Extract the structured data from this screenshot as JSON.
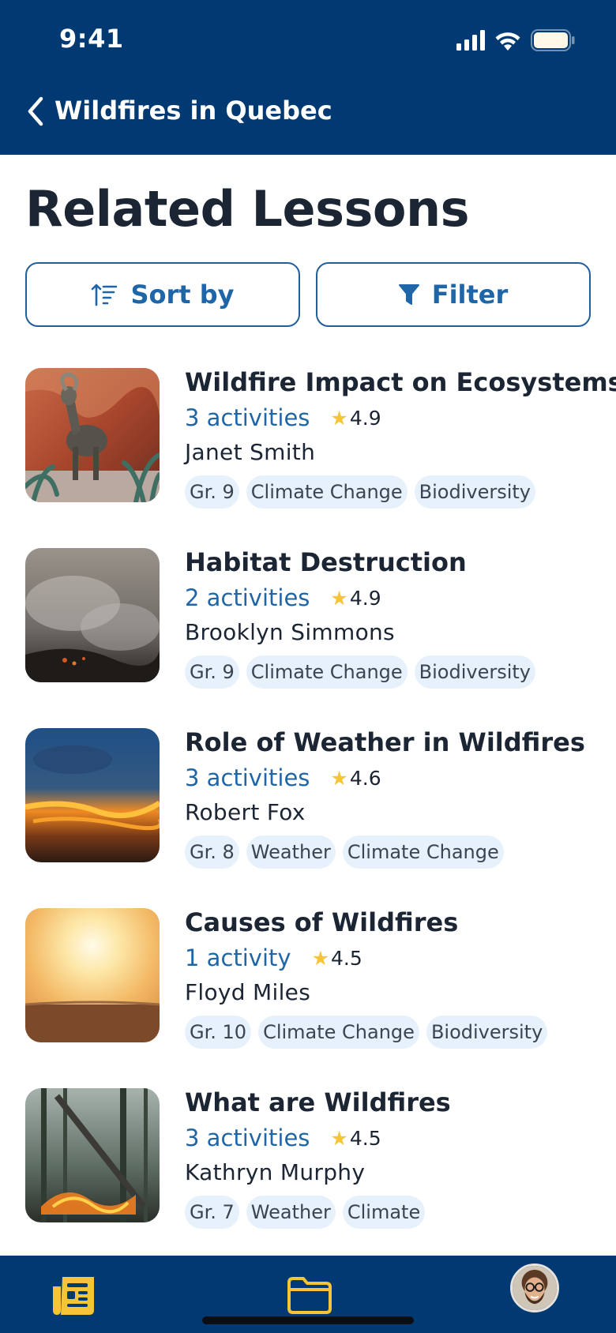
{
  "status_bar": {
    "time": "9:41"
  },
  "nav": {
    "title": "Wildfires in Quebec"
  },
  "page": {
    "title": "Related Lessons"
  },
  "controls": {
    "sort_label": "Sort by",
    "filter_label": "Filter"
  },
  "lessons": [
    {
      "title": "Wildfire Impact on Ecosystems",
      "activities": "3 activities",
      "rating": "4.9",
      "author": "Janet Smith",
      "tags": [
        "Gr. 9",
        "Climate Change",
        "Biodiversity"
      ],
      "image": "bighorn-sheep-photo"
    },
    {
      "title": "Habitat Destruction",
      "activities": "2 activities",
      "rating": "4.9",
      "author": "Brooklyn Simmons",
      "tags": [
        "Gr. 9",
        "Climate Change",
        "Biodiversity"
      ],
      "image": "smoke-hillside-photo"
    },
    {
      "title": "Role of Weather in Wildfires",
      "activities": "3 activities",
      "rating": "4.6",
      "author": "Robert Fox",
      "tags": [
        "Gr. 8",
        "Weather",
        "Climate Change"
      ],
      "image": "sunset-clouds-photo"
    },
    {
      "title": "Causes of Wildfires",
      "activities": "1 activity",
      "rating": "4.5",
      "author": "Floyd Miles",
      "tags": [
        "Gr. 10",
        "Climate Change",
        "Biodiversity"
      ],
      "image": "desert-sun-photo"
    },
    {
      "title": "What are Wildfires",
      "activities": "3 activities",
      "rating": "4.5",
      "author": "Kathryn Murphy",
      "tags": [
        "Gr. 7",
        "Weather",
        "Climate"
      ],
      "image": "forest-fire-photo"
    }
  ],
  "tabbar": {
    "items": [
      "lessons-icon",
      "folder-icon",
      "profile-avatar"
    ],
    "active": "lessons-icon"
  },
  "colors": {
    "header_bg": "#013a73",
    "accent": "#1f66a8",
    "active_tab": "#f5c437",
    "star": "#f5c437",
    "tag_bg": "#e7f1fb"
  }
}
